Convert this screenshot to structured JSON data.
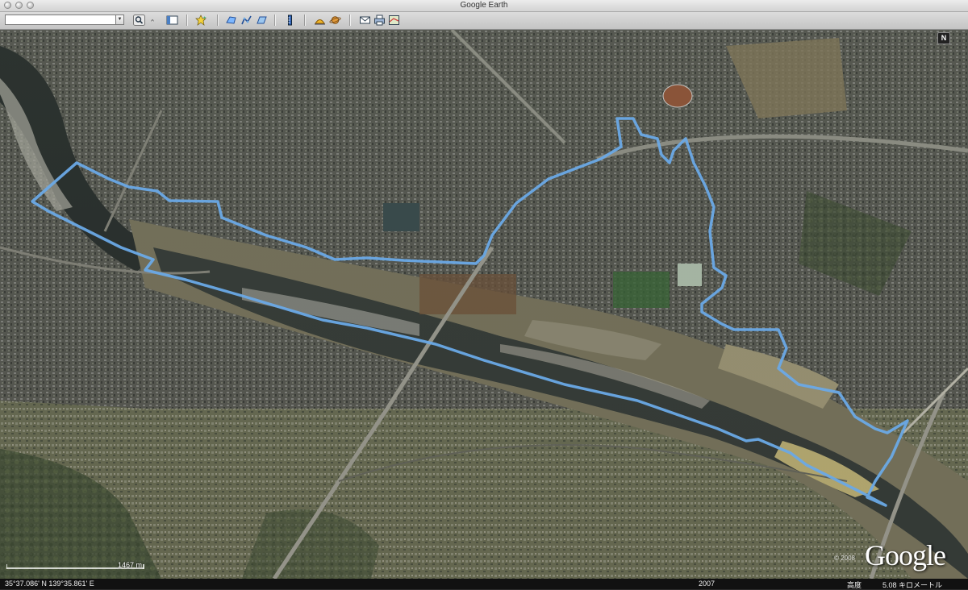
{
  "window": {
    "title": "Google Earth"
  },
  "toolbar": {
    "search_value": "",
    "buttons": [
      "search-icon",
      "sidebar-toggle-icon",
      "placemark-icon",
      "polygon-icon",
      "path-icon",
      "image-overlay-icon",
      "ruler-icon",
      "sunlight-icon",
      "planet-icon",
      "email-icon",
      "print-icon",
      "maps-icon"
    ]
  },
  "map": {
    "north_label": "N",
    "scale_label": "1467 m",
    "logo_text": "Google",
    "copyright": "© 2008",
    "track_color": "#6aa9e6"
  },
  "status": {
    "coordinates": "35°37.086' N  139°35.861' E",
    "imagery_year": "2007",
    "altitude_label": "高度",
    "altitude_value": "5.08 キロメートル"
  }
}
